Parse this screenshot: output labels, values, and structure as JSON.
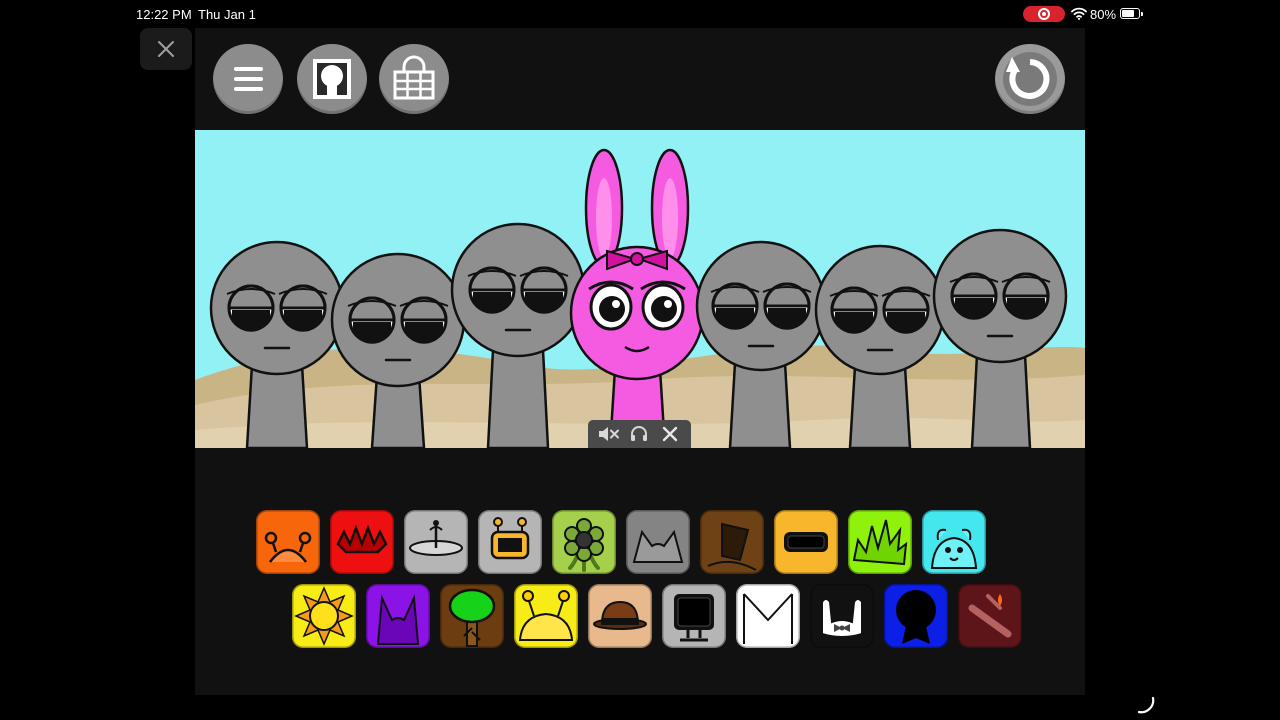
{
  "status_bar": {
    "time": "12:22 PM",
    "date": "Thu Jan 1",
    "battery_percent": "80%",
    "battery_level": 0.8
  },
  "toolbar": {
    "left_buttons": [
      "menu-icon",
      "portrait-frame-icon",
      "unlock-shop-icon"
    ],
    "right_button": "reset-icon"
  },
  "stage": {
    "sky_color": "#92f1f5",
    "ground_color": "#d8c5a0",
    "characters": [
      {
        "name": "gray",
        "color": "#8f8f8f"
      },
      {
        "name": "gray",
        "color": "#8f8f8f"
      },
      {
        "name": "gray",
        "color": "#8f8f8f"
      },
      {
        "name": "pink-bunny",
        "color": "#f55be0"
      },
      {
        "name": "gray",
        "color": "#8f8f8f"
      },
      {
        "name": "gray",
        "color": "#8f8f8f"
      },
      {
        "name": "gray",
        "color": "#8f8f8f"
      }
    ]
  },
  "mini_controls": [
    "mute-icon",
    "headphones-icon",
    "close-icon"
  ],
  "sound_palette": {
    "row1": [
      {
        "icon": "orange-antenna-icon",
        "color": "#f7660b"
      },
      {
        "icon": "red-spikes-icon",
        "color": "#ee1010"
      },
      {
        "icon": "cymbal-icon",
        "color": "#b5b5b5"
      },
      {
        "icon": "robot-screen-icon",
        "color": "#b5b5b5"
      },
      {
        "icon": "flower-icon",
        "color": "#a5d04c"
      },
      {
        "icon": "cat-ears-icon",
        "color": "#848484"
      },
      {
        "icon": "bucket-icon",
        "color": "#6e4214"
      },
      {
        "icon": "visor-icon",
        "color": "#f7b62b"
      },
      {
        "icon": "green-spiky-hair-icon",
        "color": "#8ef20d"
      },
      {
        "icon": "cyan-bear-icon",
        "color": "#44e7ee"
      }
    ],
    "row2": [
      {
        "icon": "sun-icon",
        "color": "#f7ec16"
      },
      {
        "icon": "purple-horns-icon",
        "color": "#8b13e6"
      },
      {
        "icon": "tree-icon",
        "color": "#6c3d10"
      },
      {
        "icon": "yellow-antenna-icon",
        "color": "#f7ec16"
      },
      {
        "icon": "bowler-hat-icon",
        "color": "#e7b98d"
      },
      {
        "icon": "computer-monitor-icon",
        "color": "#b5b5b5"
      },
      {
        "icon": "envelope-icon",
        "color": "#ffffff"
      },
      {
        "icon": "bunny-bow-icon",
        "color": "#111111"
      },
      {
        "icon": "blue-shadow-icon",
        "color": "#0b1fe6"
      },
      {
        "icon": "dark-red-torch-icon",
        "color": "#5d1519"
      }
    ]
  }
}
